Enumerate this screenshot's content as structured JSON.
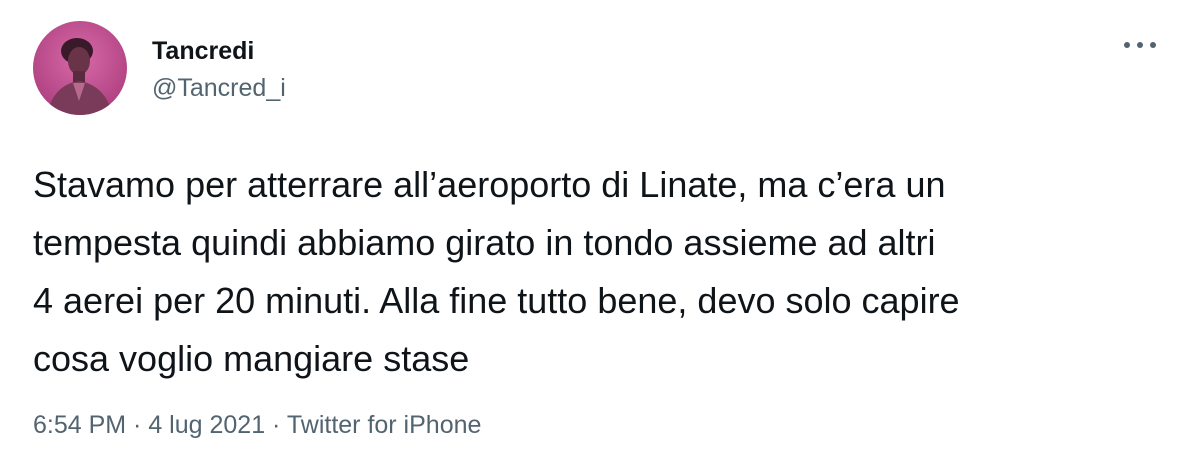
{
  "tweet": {
    "author": {
      "name": "Tancredi",
      "handle": "@Tancred_i",
      "avatar_icon": "profile-photo"
    },
    "more_icon": "more-horizontal-icon",
    "text": "Stavamo per atterrare all’aeroporto di Linate, ma c’era un\ntempesta quindi abbiamo girato in tondo assieme ad altri\n4 aerei per 20 minuti. Alla fine tutto bene, devo solo capire\ncosa voglio mangiare stase",
    "meta": {
      "time": "6:54 PM",
      "separator": " · ",
      "date": "4 lug 2021",
      "source": "Twitter for iPhone"
    }
  },
  "colors": {
    "text_primary": "#0f1419",
    "text_secondary": "#536471",
    "avatar_bg": "#c0508c"
  }
}
